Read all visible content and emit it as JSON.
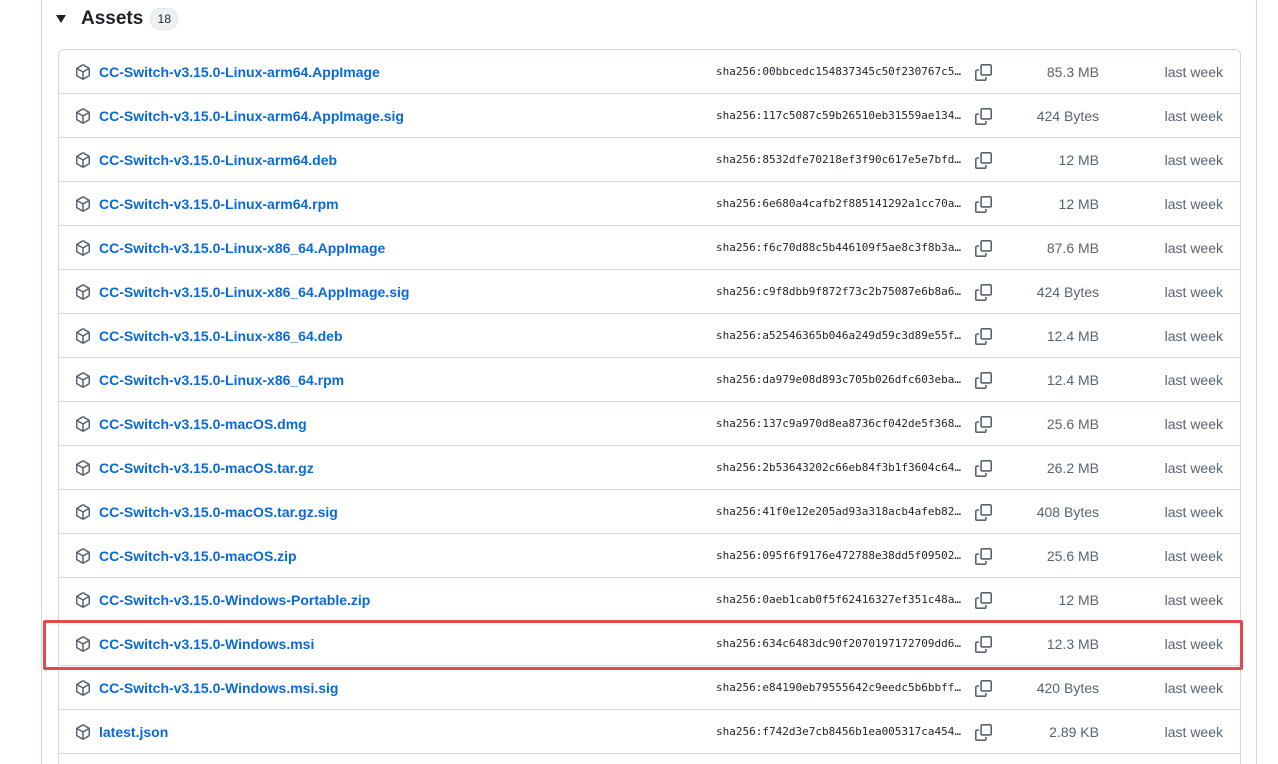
{
  "assets": {
    "title": "Assets",
    "count": "18",
    "items": [
      {
        "name": "CC-Switch-v3.15.0-Linux-arm64.AppImage",
        "sha": "sha256:00bbcedc154837345c50f230767c5...",
        "size": "85.3 MB",
        "time": "last week"
      },
      {
        "name": "CC-Switch-v3.15.0-Linux-arm64.AppImage.sig",
        "sha": "sha256:117c5087c59b26510eb31559ae134...",
        "size": "424 Bytes",
        "time": "last week"
      },
      {
        "name": "CC-Switch-v3.15.0-Linux-arm64.deb",
        "sha": "sha256:8532dfe70218ef3f90c617e5e7bfd...",
        "size": "12 MB",
        "time": "last week"
      },
      {
        "name": "CC-Switch-v3.15.0-Linux-arm64.rpm",
        "sha": "sha256:6e680a4cafb2f885141292a1cc70a...",
        "size": "12 MB",
        "time": "last week"
      },
      {
        "name": "CC-Switch-v3.15.0-Linux-x86_64.AppImage",
        "sha": "sha256:f6c70d88c5b446109f5ae8c3f8b3a...",
        "size": "87.6 MB",
        "time": "last week"
      },
      {
        "name": "CC-Switch-v3.15.0-Linux-x86_64.AppImage.sig",
        "sha": "sha256:c9f8dbb9f872f73c2b75087e6b8a6...",
        "size": "424 Bytes",
        "time": "last week"
      },
      {
        "name": "CC-Switch-v3.15.0-Linux-x86_64.deb",
        "sha": "sha256:a52546365b046a249d59c3d89e55f...",
        "size": "12.4 MB",
        "time": "last week"
      },
      {
        "name": "CC-Switch-v3.15.0-Linux-x86_64.rpm",
        "sha": "sha256:da979e08d893c705b026dfc603eba...",
        "size": "12.4 MB",
        "time": "last week"
      },
      {
        "name": "CC-Switch-v3.15.0-macOS.dmg",
        "sha": "sha256:137c9a970d8ea8736cf042de5f368...",
        "size": "25.6 MB",
        "time": "last week"
      },
      {
        "name": "CC-Switch-v3.15.0-macOS.tar.gz",
        "sha": "sha256:2b53643202c66eb84f3b1f3604c64...",
        "size": "26.2 MB",
        "time": "last week"
      },
      {
        "name": "CC-Switch-v3.15.0-macOS.tar.gz.sig",
        "sha": "sha256:41f0e12e205ad93a318acb4afeb82...",
        "size": "408 Bytes",
        "time": "last week"
      },
      {
        "name": "CC-Switch-v3.15.0-macOS.zip",
        "sha": "sha256:095f6f9176e472788e38dd5f09502...",
        "size": "25.6 MB",
        "time": "last week"
      },
      {
        "name": "CC-Switch-v3.15.0-Windows-Portable.zip",
        "sha": "sha256:0aeb1cab0f5f62416327ef351c48a...",
        "size": "12 MB",
        "time": "last week"
      },
      {
        "name": "CC-Switch-v3.15.0-Windows.msi",
        "sha": "sha256:634c6483dc90f2070197172709dd6...",
        "size": "12.3 MB",
        "time": "last week"
      },
      {
        "name": "CC-Switch-v3.15.0-Windows.msi.sig",
        "sha": "sha256:e84190eb79555642c9eedc5b6bbff...",
        "size": "420 Bytes",
        "time": "last week"
      },
      {
        "name": "latest.json",
        "sha": "sha256:f742d3e7cb8456b1ea005317ca454...",
        "size": "2.89 KB",
        "time": "last week"
      }
    ]
  },
  "icons": {
    "row_icon": "package-icon",
    "copy_icon": "copy-icon",
    "toggle_icon": "triangle-down-icon"
  },
  "colors": {
    "link": "#0969da",
    "muted": "#59636e",
    "border": "#d1d9e0",
    "highlight": "#e5484d"
  }
}
